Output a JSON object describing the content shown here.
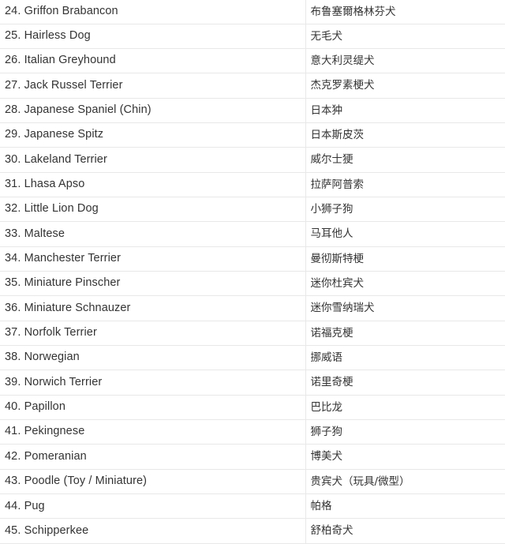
{
  "document": {
    "type": "breed-name-table",
    "columns": [
      "english_name",
      "chinese_name"
    ],
    "row_count": 22,
    "colors": {
      "text": "#333333",
      "row_divider": "#e8e8e8",
      "column_divider": "#e8e8e8",
      "background": "#ffffff"
    }
  },
  "rows": [
    {
      "index": "24.",
      "en": "24. Griffon Brabancon",
      "zh": "布鲁塞爾格林芬犬"
    },
    {
      "index": "25.",
      "en": "25. Hairless Dog",
      "zh": "无毛犬"
    },
    {
      "index": "26.",
      "en": "26. Italian Greyhound",
      "zh": "意大利灵缇犬"
    },
    {
      "index": "27.",
      "en": "27. Jack Russel Terrier",
      "zh": "杰克罗素梗犬"
    },
    {
      "index": "28.",
      "en": "28. Japanese Spaniel (Chin)",
      "zh": "日本狆"
    },
    {
      "index": "29.",
      "en": "29. Japanese Spitz",
      "zh": "日本斯皮茨"
    },
    {
      "index": "30.",
      "en": "30. Lakeland Terrier",
      "zh": "威尔士㹴"
    },
    {
      "index": "31.",
      "en": "31. Lhasa Apso",
      "zh": "拉萨阿普索"
    },
    {
      "index": "32.",
      "en": "32. Little Lion Dog",
      "zh": "小狮子狗"
    },
    {
      "index": "33.",
      "en": "33. Maltese",
      "zh": "马耳他人"
    },
    {
      "index": "34.",
      "en": "34. Manchester Terrier",
      "zh": "曼彻斯特梗"
    },
    {
      "index": "35.",
      "en": "35. Miniature Pinscher",
      "zh": "迷你杜宾犬"
    },
    {
      "index": "36.",
      "en": "36. Miniature Schnauzer",
      "zh": "迷你雪纳瑞犬"
    },
    {
      "index": "37.",
      "en": "37. Norfolk Terrier",
      "zh": "诺福克梗"
    },
    {
      "index": "38.",
      "en": "38. Norwegian",
      "zh": "挪威语"
    },
    {
      "index": "39.",
      "en": "39. Norwich Terrier",
      "zh": "诺里奇梗"
    },
    {
      "index": "40.",
      "en": "40. Papillon",
      "zh": "巴比龙"
    },
    {
      "index": "41.",
      "en": "41. Pekingnese",
      "zh": "狮子狗"
    },
    {
      "index": "42.",
      "en": "42. Pomeranian",
      "zh": "博美犬"
    },
    {
      "index": "43.",
      "en": "43. Poodle (Toy / Miniature)",
      "zh": "贵宾犬（玩具/微型）"
    },
    {
      "index": "44.",
      "en": "44. Pug",
      "zh": "帕格"
    },
    {
      "index": "45.",
      "en": "45. Schipperkee",
      "zh": "舒柏奇犬"
    }
  ]
}
